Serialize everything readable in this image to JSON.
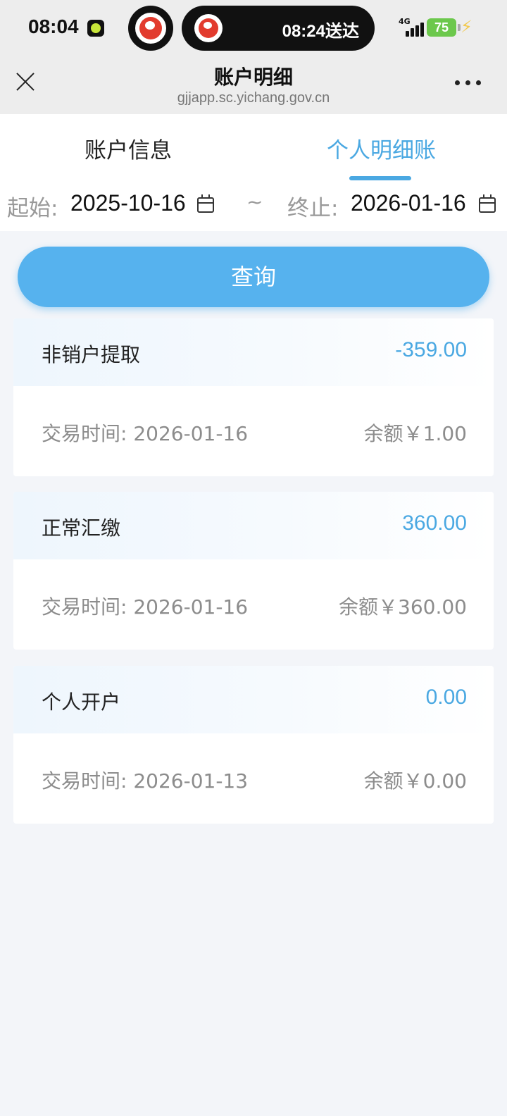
{
  "status_bar": {
    "time": "08:04",
    "island_text": "08:24送达",
    "network": "4G",
    "battery": "75"
  },
  "nav": {
    "title": "账户明细",
    "subtitle": "gjjapp.sc.yichang.gov.cn"
  },
  "tabs": [
    {
      "label": "账户信息",
      "active": false
    },
    {
      "label": "个人明细账",
      "active": true
    }
  ],
  "date_range": {
    "start_label": "起始:",
    "start_value": "2025-10-16",
    "separator": "~",
    "end_label": "终止:",
    "end_value": "2026-01-16"
  },
  "query_button": "查询",
  "transactions": [
    {
      "type": "非销户提取",
      "amount": "-359.00",
      "date": "交易时间: 2026-01-16",
      "balance": "余额￥1.00"
    },
    {
      "type": "正常汇缴",
      "amount": "360.00",
      "date": "交易时间: 2026-01-16",
      "balance": "余额￥360.00"
    },
    {
      "type": "个人开户",
      "amount": "0.00",
      "date": "交易时间: 2026-01-13",
      "balance": "余额￥0.00"
    }
  ],
  "colors": {
    "accent": "#4aa8e2",
    "button": "#56b2ee",
    "page_bg": "#f3f5f9"
  }
}
